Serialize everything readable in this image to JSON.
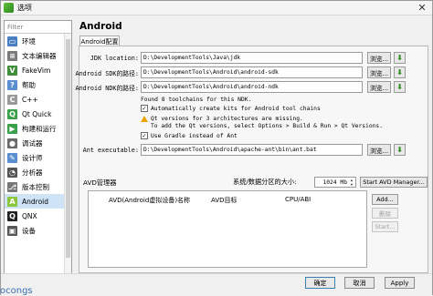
{
  "window": {
    "title": "选项"
  },
  "sidebar": {
    "filter_placeholder": "Filter",
    "items": [
      {
        "label": "环境",
        "icon": "monitor-icon",
        "color": "#4a7fc1"
      },
      {
        "label": "文本编辑器",
        "icon": "text-editor-icon",
        "color": "#7a7a7a"
      },
      {
        "label": "FakeVim",
        "icon": "fakevim-icon",
        "color": "#3f8f3a"
      },
      {
        "label": "帮助",
        "icon": "help-icon",
        "color": "#5b8dd1"
      },
      {
        "label": "C++",
        "icon": "cpp-icon",
        "color": "#9a9a9a"
      },
      {
        "label": "Qt Quick",
        "icon": "qt-quick-icon",
        "color": "#3aa14a"
      },
      {
        "label": "构建和运行",
        "icon": "build-run-icon",
        "color": "#3aa14a"
      },
      {
        "label": "调试器",
        "icon": "debugger-icon",
        "color": "#6a6a6a"
      },
      {
        "label": "设计师",
        "icon": "designer-icon",
        "color": "#5b8dd1"
      },
      {
        "label": "分析器",
        "icon": "analyzer-icon",
        "color": "#555555"
      },
      {
        "label": "版本控制",
        "icon": "version-control-icon",
        "color": "#777777"
      },
      {
        "label": "Android",
        "icon": "android-icon",
        "color": "#8cc63f"
      },
      {
        "label": "QNX",
        "icon": "qnx-icon",
        "color": "#222222"
      },
      {
        "label": "设备",
        "icon": "devices-icon",
        "color": "#555555"
      }
    ]
  },
  "main": {
    "heading": "Android",
    "tab_label": "Android配置",
    "fields": [
      {
        "label": "JDK location:",
        "value": "D:\\DevelopmentTools\\Java\\jdk"
      },
      {
        "label": "Android SDK的路径:",
        "value": "D:\\DevelopmentTools\\Android\\android-sdk"
      },
      {
        "label": "Android NDK的路径:",
        "value": "D:\\DevelopmentTools\\Android\\android-ndk"
      }
    ],
    "ndk_found": "Found 8 toolchains for this NDK.",
    "auto_toolchains": "Automatically create kits for Android tool chains",
    "warning_line1": "Qt versions for 3 architectures are missing.",
    "warning_line2": "To add the Qt versions, select Options > Build & Run > Qt Versions.",
    "gradle_label": "Use Gradle instead of Ant",
    "ant_label": "Ant executable:",
    "ant_value": "D:\\DevelopmentTools\\Android\\apache-ant\\bin\\ant.bat",
    "browse_label": "浏览...",
    "avd": {
      "title": "AVD管理器",
      "sdcard_label": "系统/数据分区的大小:",
      "sdcard_value": "1024 Mb",
      "start_manager": "Start AVD Manager...",
      "columns": [
        "AVD(Android虚拟设备)名称",
        "AVD目标",
        "CPU/ABI"
      ],
      "add": "Add...",
      "remove": "删除",
      "start": "Start..."
    }
  },
  "footer": {
    "ok": "确定",
    "cancel": "取消",
    "apply": "Apply"
  },
  "stray_text": "ocongs"
}
